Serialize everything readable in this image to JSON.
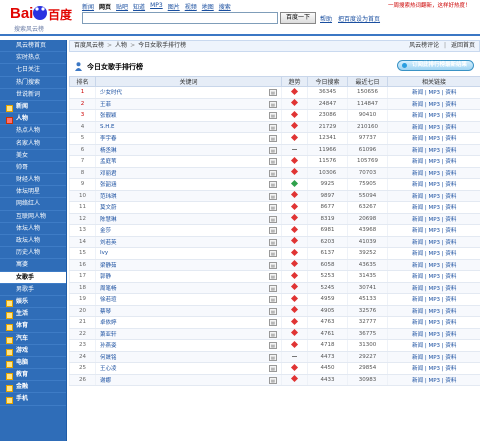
{
  "header": {
    "logo_text": "Bai百度",
    "logo_sub": "搜索风云榜",
    "nav": [
      "新闻",
      "网页",
      "贴吧",
      "知道",
      "MP3",
      "图片",
      "视频",
      "地图",
      "搜索"
    ],
    "nav_active": 1,
    "search_placeholder": "",
    "search_button": "百度一下",
    "help_link": "帮助",
    "homepage_link": "把百度设为首页",
    "top_right": "一周搜索热词翻新，这样好热度！"
  },
  "sidebar": {
    "items": [
      {
        "label": "风云榜首页",
        "kind": "top"
      },
      {
        "label": "实时热点",
        "kind": "top"
      },
      {
        "label": "七日关注",
        "kind": "top"
      },
      {
        "label": "热门搜索",
        "kind": "top"
      },
      {
        "label": "世说新词",
        "kind": "top"
      },
      {
        "label": "新闻",
        "kind": "cat"
      },
      {
        "label": "人物",
        "kind": "cat-open"
      },
      {
        "label": "热点人物",
        "kind": "sub"
      },
      {
        "label": "名家人物",
        "kind": "sub"
      },
      {
        "label": "美女",
        "kind": "sub"
      },
      {
        "label": "帅哥",
        "kind": "sub"
      },
      {
        "label": "财经人物",
        "kind": "sub"
      },
      {
        "label": "体坛明星",
        "kind": "sub"
      },
      {
        "label": "网络红人",
        "kind": "sub"
      },
      {
        "label": "互联网人物",
        "kind": "sub"
      },
      {
        "label": "体坛人物",
        "kind": "sub"
      },
      {
        "label": "政坛人物",
        "kind": "sub"
      },
      {
        "label": "历史人物",
        "kind": "sub"
      },
      {
        "label": "寓婆",
        "kind": "sub"
      },
      {
        "label": "女歌手",
        "kind": "selected"
      },
      {
        "label": "男歌手",
        "kind": "sub"
      },
      {
        "label": "娱乐",
        "kind": "cat"
      },
      {
        "label": "生活",
        "kind": "cat"
      },
      {
        "label": "体育",
        "kind": "cat"
      },
      {
        "label": "汽车",
        "kind": "cat"
      },
      {
        "label": "游戏",
        "kind": "cat"
      },
      {
        "label": "电脑",
        "kind": "cat"
      },
      {
        "label": "教育",
        "kind": "cat"
      },
      {
        "label": "金融",
        "kind": "cat"
      },
      {
        "label": "手机",
        "kind": "cat"
      }
    ]
  },
  "breadcrumb": [
    "百度风云榜",
    "人物",
    "今日女歌手排行榜"
  ],
  "breadcrumb_right": [
    "风云榜评论",
    "返回首页"
  ],
  "page_title": "今日女歌手排行榜",
  "title_button": "订阅此排行榜最新结果",
  "table": {
    "headers": [
      "排名",
      "关键词",
      "趋势",
      "今日搜索",
      "最近七日",
      "相关链接"
    ],
    "rows": [
      {
        "rank": "1",
        "kw": "少女时代",
        "trend": "up",
        "today": "36345",
        "week": "150656"
      },
      {
        "rank": "2",
        "kw": "王菲",
        "trend": "up",
        "today": "24847",
        "week": "114847"
      },
      {
        "rank": "3",
        "kw": "张靓颖",
        "trend": "up",
        "today": "23086",
        "week": "90410"
      },
      {
        "rank": "4",
        "kw": "S.H.E",
        "trend": "up",
        "today": "21729",
        "week": "210160"
      },
      {
        "rank": "5",
        "kw": "李宇春",
        "trend": "up",
        "today": "12341",
        "week": "97737"
      },
      {
        "rank": "6",
        "kw": "杨丞琳",
        "trend": "flat",
        "today": "11966",
        "week": "61096"
      },
      {
        "rank": "7",
        "kw": "孟庭苇",
        "trend": "up",
        "today": "11576",
        "week": "105769"
      },
      {
        "rank": "8",
        "kw": "邓丽君",
        "trend": "up",
        "today": "10306",
        "week": "70703"
      },
      {
        "rank": "9",
        "kw": "张韶涵",
        "trend": "down",
        "today": "9925",
        "week": "75905"
      },
      {
        "rank": "10",
        "kw": "范玮琪",
        "trend": "up",
        "today": "9897",
        "week": "55094"
      },
      {
        "rank": "11",
        "kw": "莫文蔚",
        "trend": "up",
        "today": "8677",
        "week": "63267"
      },
      {
        "rank": "12",
        "kw": "陈慧琳",
        "trend": "up",
        "today": "8319",
        "week": "20698"
      },
      {
        "rank": "13",
        "kw": "金莎",
        "trend": "up",
        "today": "6981",
        "week": "43968"
      },
      {
        "rank": "14",
        "kw": "刘若英",
        "trend": "up",
        "today": "6203",
        "week": "41039"
      },
      {
        "rank": "15",
        "kw": "Ivy",
        "trend": "up",
        "today": "6137",
        "week": "39252"
      },
      {
        "rank": "16",
        "kw": "梁静茹",
        "trend": "up",
        "today": "6058",
        "week": "43635"
      },
      {
        "rank": "17",
        "kw": "郭静",
        "trend": "up",
        "today": "5253",
        "week": "31435"
      },
      {
        "rank": "18",
        "kw": "周笔畅",
        "trend": "up",
        "today": "5245",
        "week": "30741"
      },
      {
        "rank": "19",
        "kw": "徐若瑄",
        "trend": "up",
        "today": "4959",
        "week": "45133"
      },
      {
        "rank": "20",
        "kw": "蔡琴",
        "trend": "up",
        "today": "4905",
        "week": "32576"
      },
      {
        "rank": "21",
        "kw": "卓依婷",
        "trend": "up",
        "today": "4763",
        "week": "32777"
      },
      {
        "rank": "22",
        "kw": "萧亚轩",
        "trend": "up",
        "today": "4761",
        "week": "36775"
      },
      {
        "rank": "23",
        "kw": "孙燕姿",
        "trend": "up",
        "today": "4718",
        "week": "31300"
      },
      {
        "rank": "24",
        "kw": "何晟铭",
        "trend": "flat",
        "today": "4473",
        "week": "29227"
      },
      {
        "rank": "25",
        "kw": "王心凌",
        "trend": "up",
        "today": "4450",
        "week": "29854"
      },
      {
        "rank": "26",
        "kw": "谢娜",
        "trend": "up",
        "today": "4433",
        "week": "30983"
      }
    ],
    "row_links": [
      "新闻",
      "MP3",
      "资料"
    ]
  },
  "colors": {
    "accent": "#2f6db8",
    "up": "#e03434",
    "down": "#2ea14b",
    "link": "#1a4fa0"
  }
}
